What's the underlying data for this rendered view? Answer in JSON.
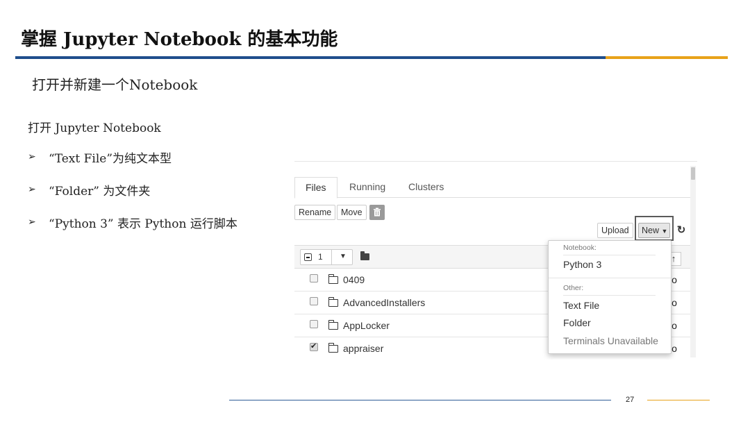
{
  "slide": {
    "title": "掌握 Jupyter Notebook 的基本功能",
    "subtitle": "打开并新建一个Notebook",
    "intro": "打开 Jupyter Notebook",
    "bullets": [
      "“Text File”为纯文本型",
      "“Folder” 为文件夹",
      "“Python 3” 表示 Python 运行脚本"
    ],
    "bullet_icon": "arrowhead-bullet",
    "page_number": "27",
    "colors": {
      "rule_blue": "#1f4e8c",
      "rule_orange": "#e8a21a"
    }
  },
  "jupyter": {
    "tabs": [
      "Files",
      "Running",
      "Clusters"
    ],
    "active_tab": "Files",
    "toolbar": {
      "rename": "Rename",
      "move": "Move",
      "upload": "Upload",
      "new": "New"
    },
    "selected_count": "1",
    "files": [
      {
        "name": "0409",
        "checked": false,
        "right": "jo"
      },
      {
        "name": "AdvancedInstallers",
        "checked": false,
        "right": "jo"
      },
      {
        "name": "AppLocker",
        "checked": false,
        "right": "jo"
      },
      {
        "name": "appraiser",
        "checked": true,
        "right": "jo"
      }
    ],
    "new_menu": {
      "notebook_header": "Notebook:",
      "python3": "Python 3",
      "other_header": "Other:",
      "text_file": "Text File",
      "folder": "Folder",
      "terminals": "Terminals Unavailable"
    }
  }
}
